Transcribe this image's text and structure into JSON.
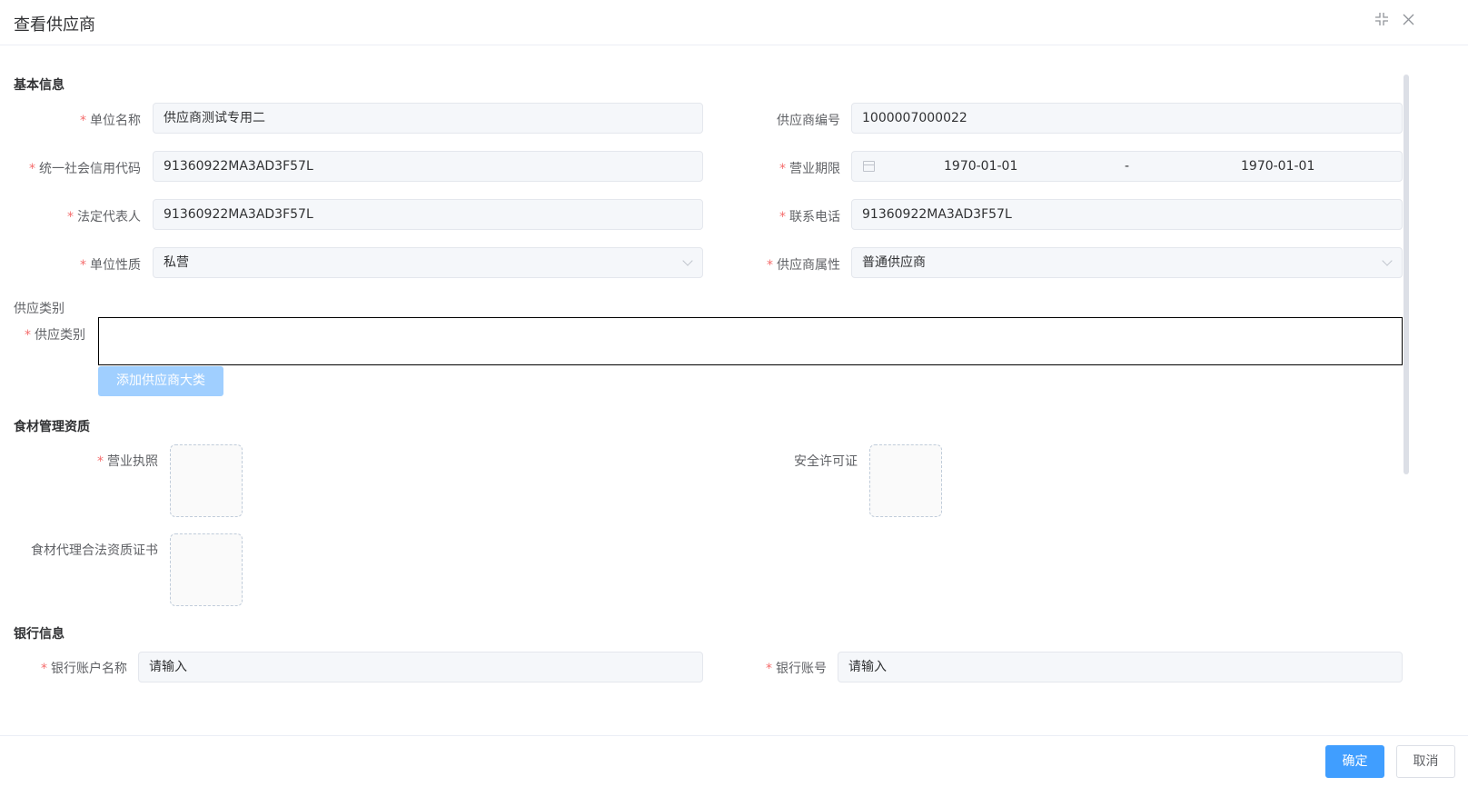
{
  "dialog": {
    "title": "查看供应商"
  },
  "sections": {
    "basic": "基本信息",
    "category_group": "供应类别",
    "food_qual": "食材管理资质",
    "bank": "银行信息"
  },
  "basic": {
    "unit_name": {
      "label": "单位名称",
      "value": "供应商测试专用二"
    },
    "supplier_code": {
      "label": "供应商编号",
      "value": "1000007000022"
    },
    "credit_code": {
      "label": "统一社会信用代码",
      "value": "91360922MA3AD3F57L"
    },
    "business_term": {
      "label": "营业期限",
      "start": "1970-01-01",
      "separator": "-",
      "end": "1970-01-01"
    },
    "legal_rep": {
      "label": "法定代表人",
      "value": "91360922MA3AD3F57L"
    },
    "phone": {
      "label": "联系电话",
      "value": "91360922MA3AD3F57L"
    },
    "unit_nature": {
      "label": "单位性质",
      "value": "私营"
    },
    "supplier_attr": {
      "label": "供应商属性",
      "value": "普通供应商"
    }
  },
  "category": {
    "label": "供应类别",
    "add_button": "添加供应商大类"
  },
  "food_qual": {
    "license": {
      "label": "营业执照"
    },
    "safety": {
      "label": "安全许可证"
    },
    "agent_cert": {
      "label": "食材代理合法资质证书"
    }
  },
  "bank": {
    "account_name": {
      "label": "银行账户名称",
      "value": "请输入"
    },
    "account_no": {
      "label": "银行账号",
      "value": "请输入"
    }
  },
  "footer": {
    "ok": "确定",
    "cancel": "取消"
  },
  "colors": {
    "primary": "#409eff",
    "required": "#f56c6c",
    "disabled_primary": "#a0cfff"
  }
}
